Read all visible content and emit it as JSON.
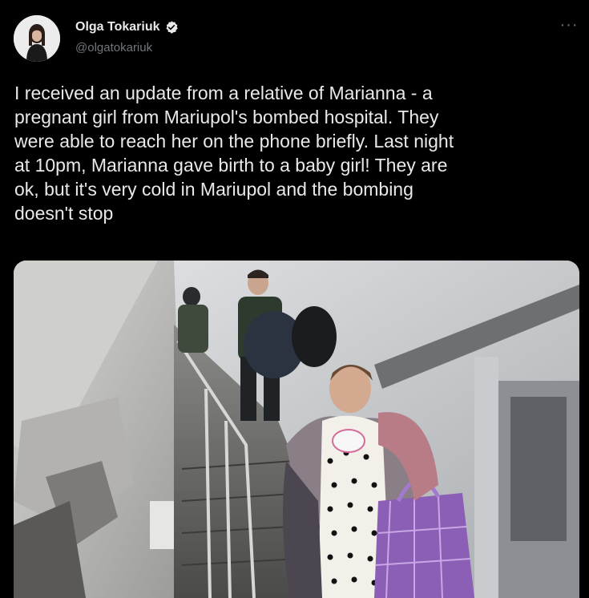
{
  "author": {
    "display_name": "Olga Tokariuk",
    "handle": "@olgatokariuk",
    "avatar_icon": "avatar-photo",
    "verified_icon": "verified-badge-icon"
  },
  "more_icon": "more-options-icon",
  "more_label": "···",
  "tweet": {
    "text": "I received an update from a relative of Marianna - a\npregnant girl from Mariupol's bombed hospital. They\nwere able to reach her on the phone briefly. Last night\nat 10pm, Marianna gave birth to a baby girl! They are\nok, but it's very cold in Mariupol and the bombing\ndoesn't stop"
  },
  "media": {
    "type": "photo"
  },
  "colors": {
    "background": "#000000",
    "text": "#e7e9ea",
    "secondary_text": "#71767b",
    "verified": "#1d9bf0"
  }
}
